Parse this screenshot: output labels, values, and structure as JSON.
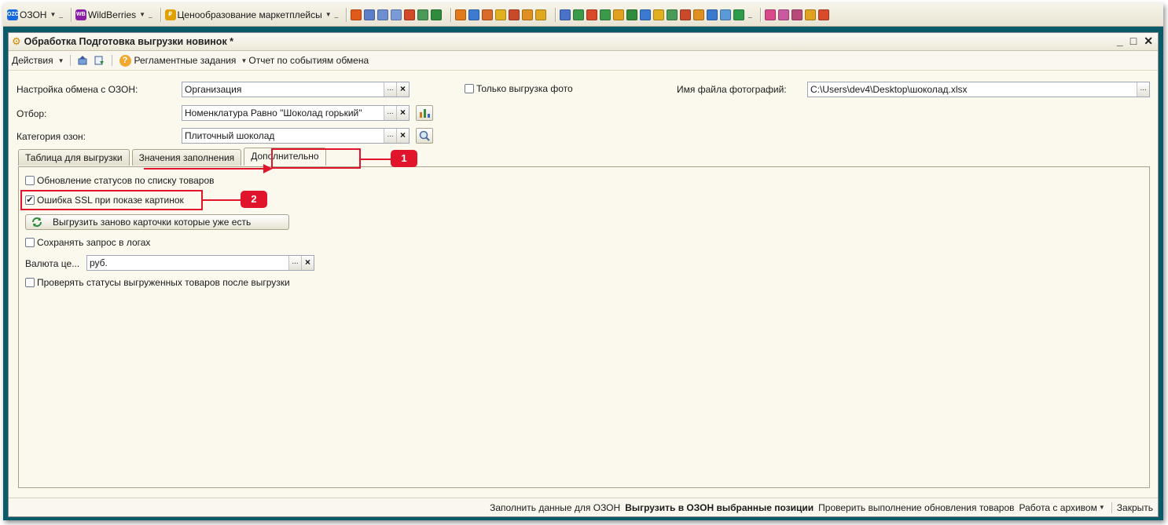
{
  "toolbar": {
    "menus": [
      {
        "badge": "OZON",
        "label": "ОЗОН"
      },
      {
        "badge": "WB",
        "label": "WildBerries"
      },
      {
        "badge": "₽",
        "label": "Ценообразование маркетплейсы"
      }
    ]
  },
  "window": {
    "title": "Обработка  Подготовка выгрузки новинок *",
    "controls": {
      "minimize": "_",
      "maximize": "□",
      "close": "✕"
    }
  },
  "commandbar": {
    "actions_label": "Действия",
    "scheduled_tasks_label": "Регламентные задания",
    "exchange_report_label": "Отчет по событиям обмена"
  },
  "form": {
    "exchange_setting_label": "Настройка обмена с ОЗОН:",
    "exchange_setting_value": "Организация",
    "filter_label": "Отбор:",
    "filter_value": "Номенклатура Равно \"Шоколад горький\"",
    "category_label": "Категория озон:",
    "category_value": "Плиточный шоколад",
    "photo_only_label": "Только выгрузка фото",
    "photo_file_label": "Имя файла фотографий:",
    "photo_file_value": "C:\\Users\\dev4\\Desktop\\шоколад.xlsx"
  },
  "tabs": [
    {
      "label": "Таблица для выгрузки"
    },
    {
      "label": "Значения заполнения"
    },
    {
      "label": "Дополнительно"
    }
  ],
  "extra": {
    "update_statuses_label": "Обновление статусов по списку товаров",
    "ssl_error_label": "Ошибка SSL при показе картинок",
    "reupload_button_label": "Выгрузить заново карточки которые уже есть",
    "save_request_label": "Сохранять запрос в логах",
    "currency_label": "Валюта це...",
    "currency_value": "руб.",
    "check_statuses_label": "Проверять статусы выгруженных товаров после выгрузки"
  },
  "annotations": {
    "marker1": "1",
    "marker2": "2",
    "color": "#e0142a"
  },
  "bottombar": {
    "fill_label": "Заполнить данные для ОЗОН",
    "upload_label": "Выгрузить в ОЗОН выбранные позиции",
    "check_update_label": "Проверить выполнение обновления товаров",
    "archive_label": "Работа с архивом",
    "close_label": "Закрыть"
  }
}
